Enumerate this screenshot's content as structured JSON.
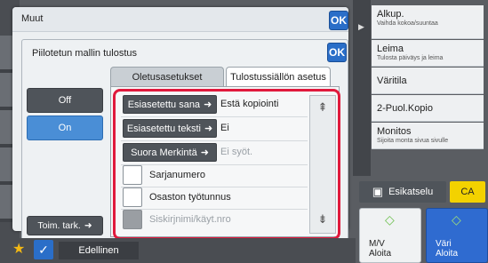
{
  "outer_dialog": {
    "title": "Muut",
    "ok_label": "OK"
  },
  "inner_dialog": {
    "title": "Piilotetun mallin tulostus",
    "ok_label": "OK"
  },
  "tabs": [
    {
      "label": "Oletusasetukset",
      "active": false
    },
    {
      "label": "Tulostussiällön asetus",
      "active": true
    }
  ],
  "left_buttons": {
    "off_label": "Off",
    "on_label": "On",
    "toim_label": "Toim. tark."
  },
  "rows": [
    {
      "button": "Esiasetettu sana",
      "value": "Estä kopiointi",
      "disabled": false
    },
    {
      "button": "Esiasetettu teksti",
      "value": "Ei",
      "disabled": false
    },
    {
      "button": "Suora Merkintä",
      "value": "Ei syöt.",
      "disabled": true
    }
  ],
  "checkboxes": [
    {
      "label": "Sarjanumero",
      "disabled": false
    },
    {
      "label": "Osaston työtunnus",
      "disabled": false
    },
    {
      "label": "Siskirjnimi/käyt.nro",
      "disabled": true
    }
  ],
  "right_panel": {
    "items": [
      {
        "label": "Alkup.",
        "sub": "Vaihda kokoa/suuntaa"
      },
      {
        "label": "Leima",
        "sub": "Tulosta päiväys ja leima"
      },
      {
        "label": "Väritila",
        "sub": ""
      },
      {
        "label": "2-Puol.Kopio",
        "sub": ""
      },
      {
        "label": "Monitos",
        "sub": "Sijoita monta sivua sivulle"
      }
    ],
    "preview_label": "Esikatselu",
    "ca_label": "CA",
    "start_bw": "M/V\nAloita",
    "start_color": "Väri\nAloita"
  },
  "bottom_bar": {
    "back_label": "Edellinen"
  },
  "colors": {
    "highlight": "#e0193c",
    "accent": "#2a6ec8",
    "ca": "#f3d200"
  }
}
